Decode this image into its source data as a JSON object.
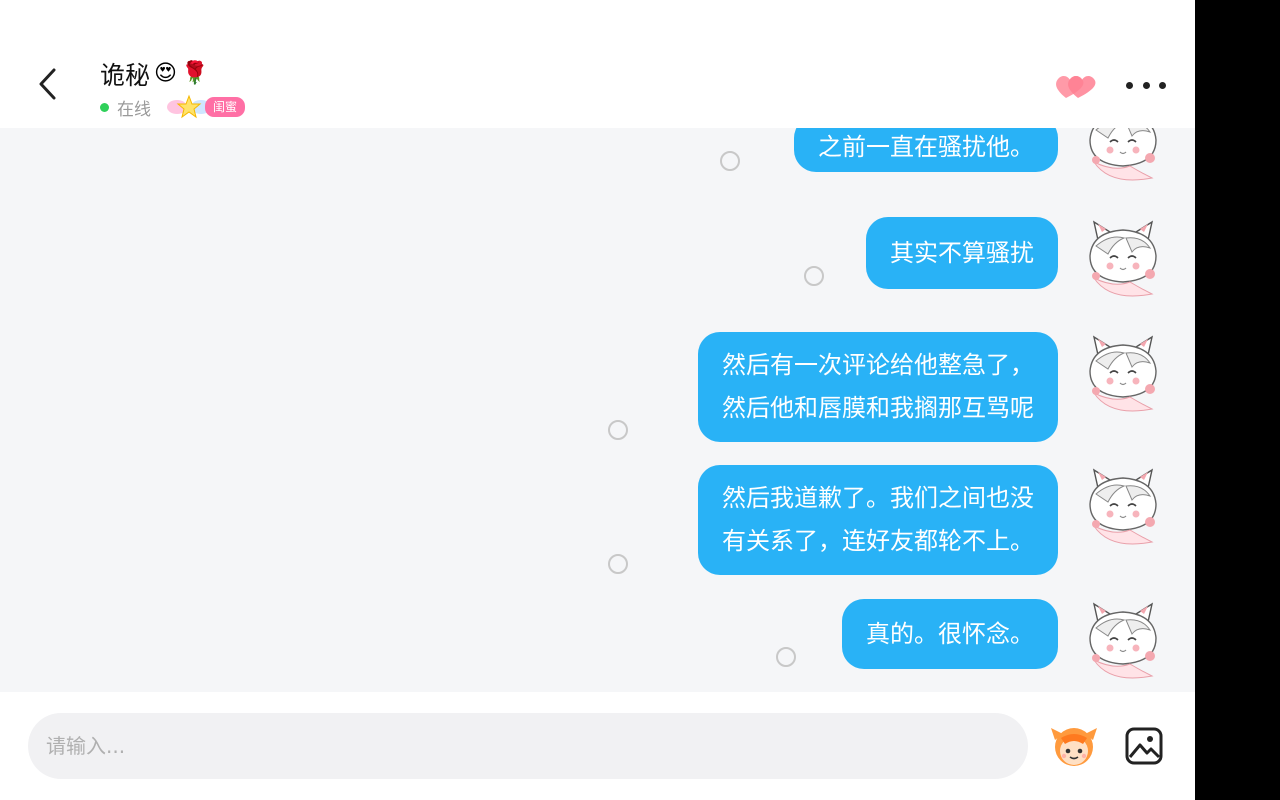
{
  "header": {
    "title": "诡秘",
    "title_emoji_1": "😍",
    "title_emoji_2": "🌹",
    "status": "在线",
    "relation_badge": "闺蜜"
  },
  "messages": [
    {
      "text": "之前一直在骚扰他。",
      "lines": [
        "之前一直在骚扰他。"
      ]
    },
    {
      "text": "其实不算骚扰",
      "lines": [
        "其实不算骚扰"
      ]
    },
    {
      "text": "然后有一次评论给他整急了，然后他和唇膜和我搁那互骂呢",
      "lines": [
        "然后有一次评论给他整急了，",
        "然后他和唇膜和我搁那互骂呢"
      ]
    },
    {
      "text": "然后我道歉了。我们之间也没有关系了，连好友都轮不上。",
      "lines": [
        "然后我道歉了。我们之间也没",
        "有关系了，连好友都轮不上。"
      ]
    },
    {
      "text": "真的。很怀念。",
      "lines": [
        "真的。很怀念。"
      ]
    }
  ],
  "input": {
    "placeholder": "请输入...",
    "value": ""
  },
  "icons": {
    "back": "chevron-left-icon",
    "intimacy": "double-heart-icon",
    "more": "more-dots-icon",
    "sticker": "sticker-face-icon",
    "image": "image-icon"
  },
  "colors": {
    "bubble": "#29b2f6",
    "online": "#2fd05a",
    "badge": "#ff6fa5",
    "heart": "#ff8a9a"
  }
}
